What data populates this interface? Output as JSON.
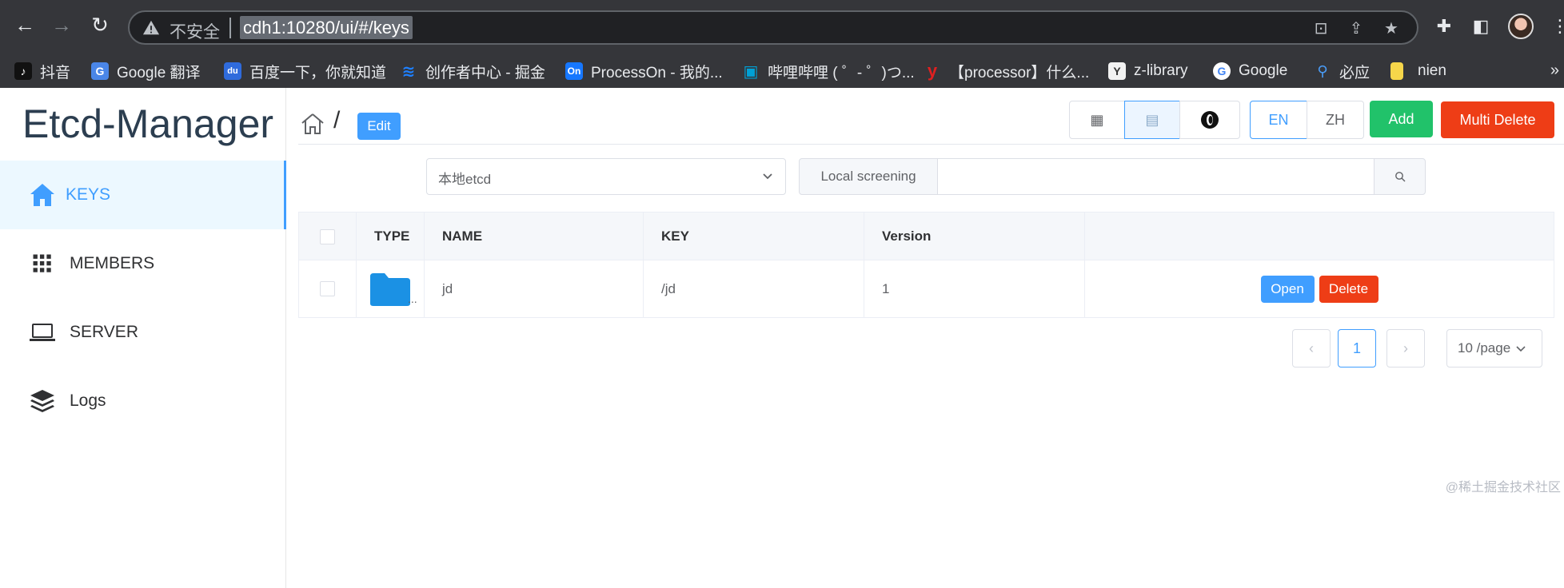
{
  "browser": {
    "insecure_label": "不安全",
    "url": "cdh1:10280/ui/#/keys",
    "bookmarks": [
      {
        "icon": "tiktok-icon",
        "label": "抖音",
        "color": "#111111",
        "glyph": "♪"
      },
      {
        "icon": "google-translate-icon",
        "label": "Google 翻译",
        "color": "#4a86e8",
        "glyph": "G"
      },
      {
        "icon": "baidu-icon",
        "label": "百度一下，你就知道",
        "color": "#2f6bdc",
        "glyph": "du"
      },
      {
        "icon": "juejin-icon",
        "label": "创作者中心 - 掘金",
        "color": "#1e80ff",
        "glyph": "≋"
      },
      {
        "icon": "processon-icon",
        "label": "ProcessOn - 我的...",
        "color": "#1677ff",
        "glyph": "On"
      },
      {
        "icon": "bilibili-icon",
        "label": "哔哩哔哩 ( ゜- ゜)つ...",
        "color": "#00a1d6",
        "glyph": "▣"
      },
      {
        "icon": "youdao-icon",
        "label": "【processor】什么...",
        "color": "#e02020",
        "glyph": "y"
      },
      {
        "icon": "zlibrary-icon",
        "label": "z-library",
        "color": "#f2f2f2",
        "glyph": "Y"
      },
      {
        "icon": "google-icon",
        "label": "Google",
        "color": "#ffffff",
        "glyph": "G"
      },
      {
        "icon": "bing-search-icon",
        "label": "必应",
        "color": "#35363a",
        "glyph": "⚲"
      },
      {
        "icon": "bookmark-folder-icon",
        "label": "nien",
        "color": "#f6d64a",
        "glyph": ""
      }
    ],
    "more": "»"
  },
  "app": {
    "title": "Etcd-Manager",
    "menu": [
      {
        "id": "keys",
        "label": "KEYS",
        "icon": "home-icon",
        "active": true
      },
      {
        "id": "members",
        "label": "MEMBERS",
        "icon": "grid-icon",
        "active": false
      },
      {
        "id": "server",
        "label": "SERVER",
        "icon": "laptop-icon",
        "active": false
      },
      {
        "id": "logs",
        "label": "Logs",
        "icon": "layers-icon",
        "active": false
      }
    ]
  },
  "toolbar": {
    "breadcrumb_sep": "/",
    "edit_label": "Edit",
    "lang_en": "EN",
    "lang_zh": "ZH",
    "add_label": "Add",
    "multi_delete_label": "Multi Delete"
  },
  "filter": {
    "etcd_selected": "本地etcd",
    "search_prepend": "Local screening",
    "search_value": ""
  },
  "table": {
    "columns": [
      "",
      "TYPE",
      "NAME",
      "KEY",
      "Version",
      ""
    ],
    "rows": [
      {
        "type": "folder",
        "type_more": "...",
        "name": "jd",
        "key": "/jd",
        "version": "1",
        "open": "Open",
        "delete": "Delete"
      }
    ]
  },
  "pagination": {
    "current_page": "1",
    "page_size": "10 /page",
    "prev": "‹",
    "next": "›"
  },
  "watermark": "@稀土掘金技术社区"
}
